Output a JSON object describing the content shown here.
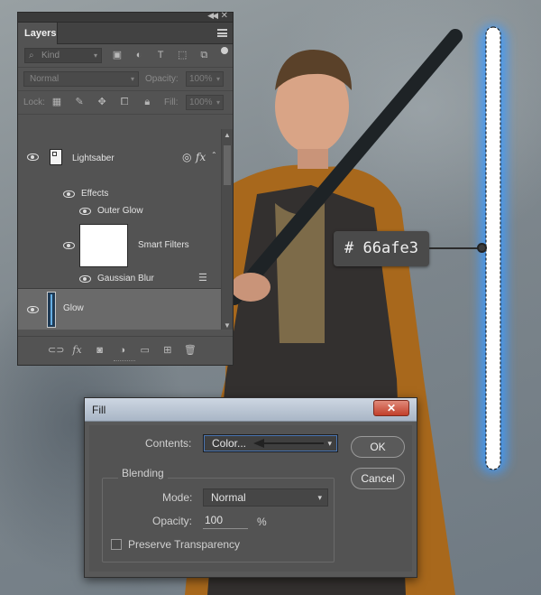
{
  "layers_panel": {
    "tab_title": "Layers",
    "kind_filter": "Kind",
    "blend_mode": "Normal",
    "opacity_label": "Opacity:",
    "opacity_value": "100%",
    "lock_label": "Lock:",
    "fill_label": "Fill:",
    "fill_value": "100%",
    "layers": [
      {
        "name": "Lightsaber",
        "type": "smart-object",
        "badges": [
          "smart-filter-icon",
          "fx-icon"
        ]
      },
      {
        "name": "Effects",
        "type": "effects-group"
      },
      {
        "name": "Outer Glow",
        "type": "effect"
      },
      {
        "name": "Smart Filters",
        "type": "smart-filter-mask"
      },
      {
        "name": "Gaussian Blur",
        "type": "filter"
      },
      {
        "name": "Glow",
        "type": "layer",
        "selected": true
      }
    ],
    "fx_badge": "fx",
    "bottom_fx": "fx"
  },
  "color_callout": {
    "hex": "# 66afe3",
    "color": "#66afe3"
  },
  "fill_dialog": {
    "title": "Fill",
    "close_label": "✕",
    "contents_label": "Contents:",
    "contents_value": "Color...",
    "blending_label": "Blending",
    "mode_label": "Mode:",
    "mode_value": "Normal",
    "opacity_label": "Opacity:",
    "opacity_value": "100",
    "opacity_unit": "%",
    "preserve_transparency_label": "Preserve Transparency",
    "preserve_transparency_checked": false,
    "ok_label": "OK",
    "cancel_label": "Cancel"
  },
  "colors": {
    "panel_bg": "#535353",
    "selected_layer_bg": "#6a6a6a",
    "glow_blue": "#66afe3",
    "cloak_orange": "#a8681c"
  }
}
